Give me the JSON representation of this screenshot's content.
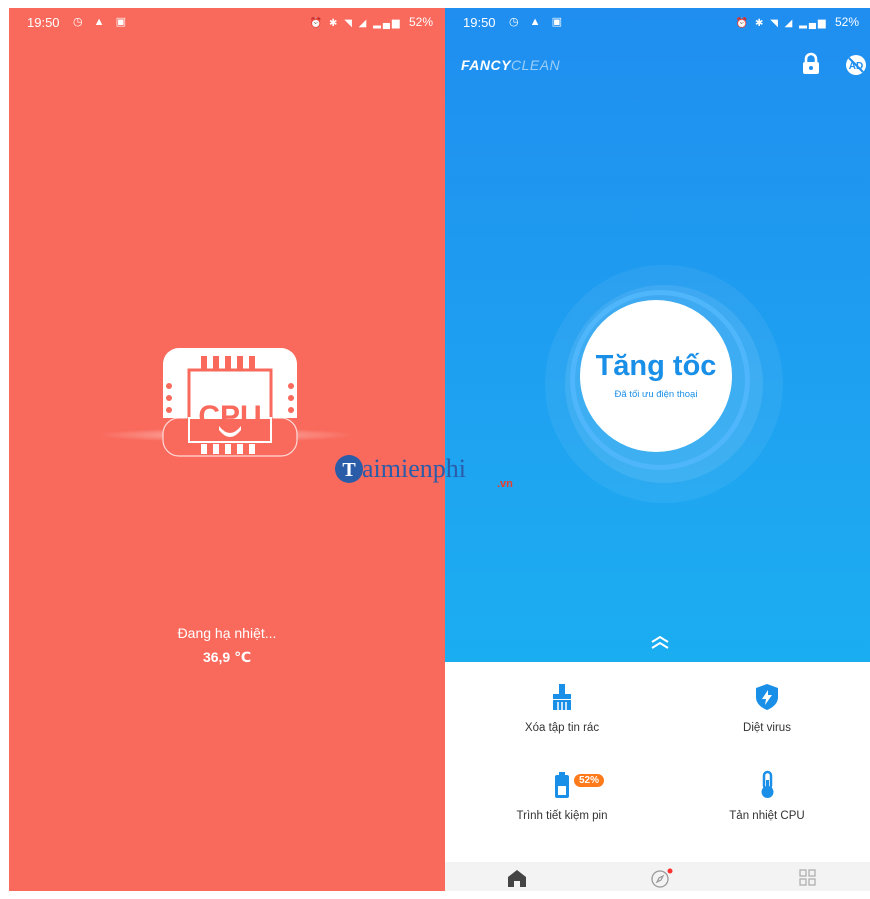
{
  "left_screen": {
    "status": {
      "time": "19:50",
      "battery": "52%"
    },
    "cpu_icon_label": "CPU",
    "status_text": "Đang hạ nhiệt...",
    "temperature": "36,9 ℃",
    "background_color": "#f96a5d"
  },
  "right_screen": {
    "status": {
      "time": "19:50",
      "battery": "52%"
    },
    "brand": {
      "bold": "FANCY",
      "light": "CLEAN"
    },
    "boost": {
      "title": "Tăng tốc",
      "subtitle": "Đã tối ưu điện thoại"
    },
    "features": [
      {
        "label": "Xóa tập tin rác",
        "icon": "broom-icon"
      },
      {
        "label": "Diệt virus",
        "icon": "shield-bolt-icon"
      },
      {
        "label": "Trình tiết kiệm pin",
        "icon": "battery-icon",
        "badge": "52%"
      },
      {
        "label": "Tản nhiệt CPU",
        "icon": "thermometer-icon"
      }
    ],
    "nav": [
      {
        "name": "home",
        "icon": "home-icon",
        "active": true
      },
      {
        "name": "explore",
        "icon": "compass-icon",
        "has_dot": true
      },
      {
        "name": "apps",
        "icon": "grid-icon"
      }
    ],
    "accent_color": "#1a8fe8",
    "badge_color": "#ff7a1a"
  },
  "watermark": {
    "text": "aimienphi",
    "suffix": ".vn"
  }
}
